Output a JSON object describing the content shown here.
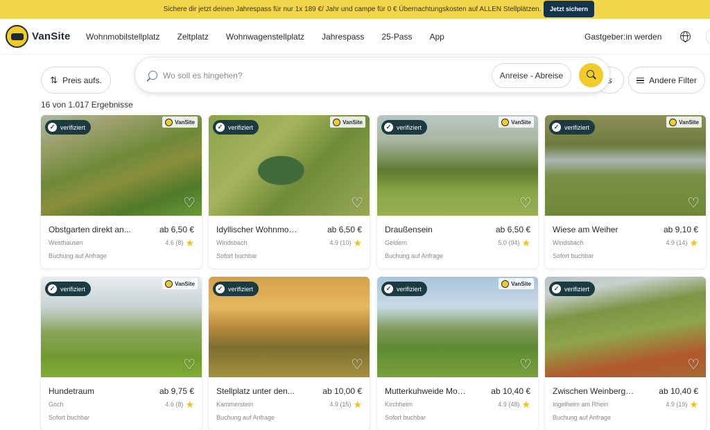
{
  "promo": {
    "text": "Sichere dir jetzt deinen Jahrespass für nur 1x 189 €/ Jahr und campe für 0 € Übernachtungskosten auf ALLEN Stellplätzen.",
    "button": "Jetzt sichern"
  },
  "nav": {
    "brand": "VanSite",
    "links": [
      "Wohnmobilstellplatz",
      "Zeltplatz",
      "Wohnwagenstellplatz",
      "Jahrespass",
      "25-Pass",
      "App"
    ],
    "host": "Gastgeber:in werden"
  },
  "filters": {
    "sort": "Preis aufs.",
    "hidden_pill": "is",
    "other": "Andere Filter"
  },
  "search": {
    "placeholder": "Wo soll es hingehen?",
    "dates": "Anreise - Abreise"
  },
  "results": {
    "count": "16 von 1.017 Ergebnisse"
  },
  "card_labels": {
    "verified": "verifiziert",
    "brand": "VanSite"
  },
  "listings": [
    {
      "title": "Obstgarten direkt an...",
      "price": "ab 6,50 €",
      "location": "Westhausen",
      "rating": "4.6 (8)",
      "booking": "Buchung auf Anfrage"
    },
    {
      "title": "Idyllischer Wohnmobi...",
      "price": "ab 6,50 €",
      "location": "Windsbach",
      "rating": "4.9 (10)",
      "booking": "Sofort buchbar"
    },
    {
      "title": "Draußensein",
      "price": "ab 6,50 €",
      "location": "Geldern",
      "rating": "5.0 (94)",
      "booking": "Buchung auf Anfrage"
    },
    {
      "title": "Wiese am Weiher",
      "price": "ab 9,10 €",
      "location": "Windsbach",
      "rating": "4.9 (14)",
      "booking": "Sofort buchbar"
    },
    {
      "title": "Hundetraum",
      "price": "ab 9,75 €",
      "location": "Goch",
      "rating": "4.6 (8)",
      "booking": "Sofort buchbar"
    },
    {
      "title": "Stellplatz unter den...",
      "price": "ab 10,00 €",
      "location": "Kammerstein",
      "rating": "4.9 (15)",
      "booking": "Buchung auf Anfrage"
    },
    {
      "title": "Mutterkuhweide Moost...",
      "price": "ab 10,40 €",
      "location": "Kirchheim",
      "rating": "4.9 (48)",
      "booking": "Sofort buchbar"
    },
    {
      "title": "Zwischen Weinbergen ...",
      "price": "ab 10,40 €",
      "location": "Ingelheim am Rhein",
      "rating": "4.9 (19)",
      "booking": "Buchung auf Anfrage"
    }
  ],
  "colors": {
    "accent": "#f1cb2a",
    "promo_bg": "#f1d54a",
    "badge": "#1c3a42",
    "button_dark": "#13344a"
  },
  "icons": [
    "sort-arrows-icon",
    "search-icon",
    "filter-sliders-icon",
    "globe-icon",
    "heart-icon",
    "check-icon",
    "star-icon"
  ]
}
